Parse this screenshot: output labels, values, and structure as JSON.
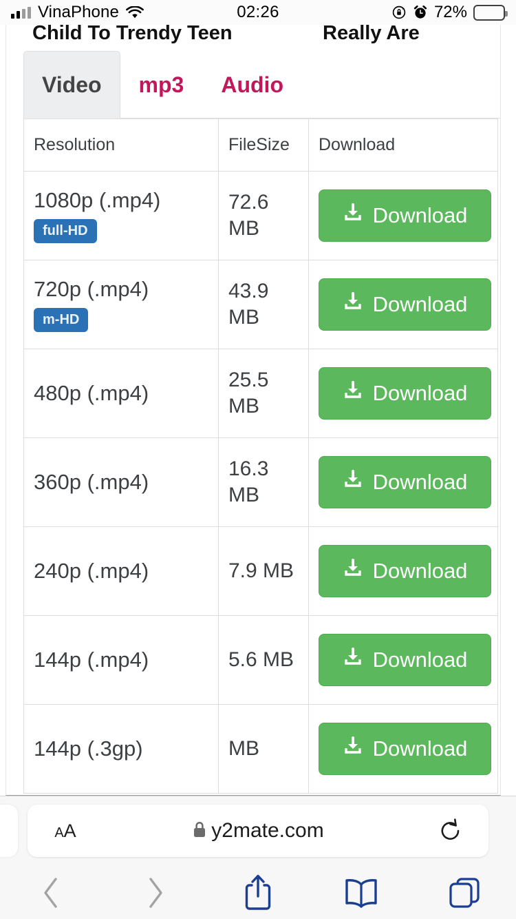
{
  "status_bar": {
    "carrier": "VinaPhone",
    "time": "02:26",
    "battery_percent": "72%",
    "battery_color": "#b5530f",
    "icons": [
      "signal-bars-icon",
      "wifi-icon",
      "rotation-lock-icon",
      "alarm-icon",
      "battery-icon"
    ]
  },
  "page": {
    "ad_text_left": "Child To Trendy Teen",
    "ad_text_right": "Really Are",
    "tabs": [
      {
        "label": "Video",
        "active": true
      },
      {
        "label": "mp3",
        "active": false
      },
      {
        "label": "Audio",
        "active": false
      }
    ],
    "accent_tab_color": "#c2185b",
    "table": {
      "headers": [
        "Resolution",
        "FileSize",
        "Download"
      ],
      "rows": [
        {
          "resolution": "1080p (.mp4)",
          "badge": "full-HD",
          "filesize": "72.6 MB",
          "action": "Download"
        },
        {
          "resolution": "720p (.mp4)",
          "badge": "m-HD",
          "filesize": "43.9 MB",
          "action": "Download"
        },
        {
          "resolution": "480p (.mp4)",
          "badge": "",
          "filesize": "25.5 MB",
          "action": "Download"
        },
        {
          "resolution": "360p (.mp4)",
          "badge": "",
          "filesize": "16.3 MB",
          "action": "Download"
        },
        {
          "resolution": "240p (.mp4)",
          "badge": "",
          "filesize": "7.9 MB",
          "action": "Download"
        },
        {
          "resolution": "144p (.mp4)",
          "badge": "",
          "filesize": "5.6 MB",
          "action": "Download"
        },
        {
          "resolution": "144p (.3gp)",
          "badge": "",
          "filesize": "MB",
          "action": "Download"
        }
      ],
      "download_button_color": "#5cb85c",
      "badge_color": "#2a72b5"
    }
  },
  "browser": {
    "text_size_label": "AA",
    "url": "y2mate.com",
    "secure": true,
    "icons": [
      "lock-icon",
      "reload-icon",
      "back-icon",
      "forward-icon",
      "share-icon",
      "bookmarks-icon",
      "tabs-icon"
    ]
  }
}
